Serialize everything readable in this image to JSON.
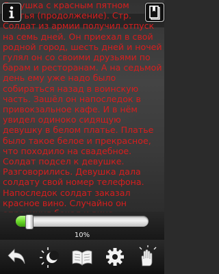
{
  "reading": {
    "paragraph": "Девушка с красным пятном платья (продолжение). Стр. Солдат из армии получил отпуск на семь дней. Он приехал в свой родной город, шесть дней и ночей гулял он со своими друзьями по барам и ресторанам. А на седьмой день ему уже надо было собираться назад в воинскую часть. Зашёл он напоследок в привокзальное кафе. И в нём увидел одиноко сидящую девушку в белом платье. Платье было такое белое и прекрасное, что походило на свадебное. Солдат подсел к девушке. Разговорились. Девушка дала солдату свой номер телефона. Напоследок солдат заказал красное вино. Случайно он опрокинул бокал и вино пролилось на платье девушки. Она сразу заплакала и выбежала из кафе."
  },
  "progress": {
    "percent_label": "10%",
    "value": 0.1
  },
  "toolbar": {
    "items": [
      {
        "icon": "back-arrow-icon"
      },
      {
        "icon": "day-night-icon"
      },
      {
        "icon": "open-book-icon"
      },
      {
        "icon": "settings-gear-icon"
      },
      {
        "icon": "hand-pointer-icon"
      }
    ]
  },
  "colors": {
    "text": "#d81e1e",
    "progress_fill": "#6ddc2a"
  }
}
